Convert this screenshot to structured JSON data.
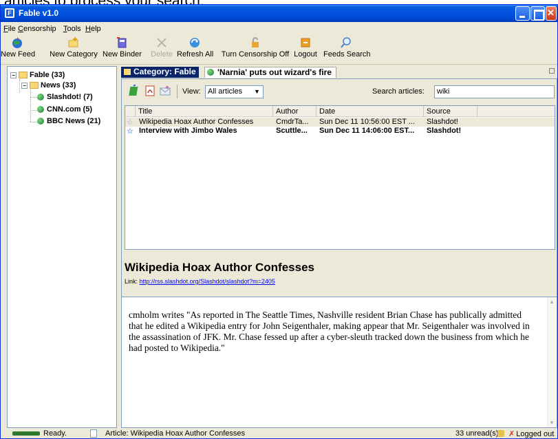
{
  "clipped_caption": "articles to process your search.",
  "window": {
    "title": "Fable v1.0"
  },
  "menu": [
    "File",
    "Censorship",
    "Tools",
    "Help"
  ],
  "toolbar": {
    "new_feed": "New Feed",
    "new_category": "New Category",
    "new_binder": "New Binder",
    "delete": "Delete",
    "refresh_all": "Refresh All",
    "turn_censorship_off": "Turn Censorship Off",
    "logout": "Logout",
    "feeds_search": "Feeds Search"
  },
  "tree": {
    "root": "Fable (33)",
    "news": "News (33)",
    "feeds": [
      "Slashdot! (7)",
      "CNN.com (5)",
      "BBC News (21)"
    ]
  },
  "tabs": {
    "active": "Category: Fable",
    "second": "'Narnia' puts out wizard's fire"
  },
  "filters": {
    "view_label": "View:",
    "view_value": "All articles",
    "search_label": "Search articles:",
    "search_value": "wiki"
  },
  "list": {
    "columns": [
      "Title",
      "Author",
      "Date",
      "Source"
    ],
    "rows": [
      {
        "title": "Wikipedia Hoax Author Confesses",
        "author": "CmdrTa...",
        "date": "Sun Dec 11 10:56:00 EST ...",
        "source": "Slashdot!",
        "unread": false
      },
      {
        "title": "Interview with Jimbo Wales",
        "author": "Scuttle...",
        "date": "Sun Dec 11 14:06:00 EST...",
        "source": "Slashdot!",
        "unread": true
      }
    ]
  },
  "article": {
    "title": "Wikipedia Hoax Author Confesses",
    "link_label": "Link:",
    "link_url": "http://rss.slashdot.org/Slashdot/slashdot?m=2405",
    "body": "cmholm writes \"As reported in The Seattle Times, Nashville resident Brian Chase has publically admitted that he edited a Wikipedia entry for John Seigenthaler, making appear that Mr. Seigenthaler was involved in the assassination of JFK. Mr. Chase fessed up after a cyber-sleuth tracked down the business from which he had posted to Wikipedia.\""
  },
  "status": {
    "ready": "Ready.",
    "article": "Article: Wikipedia Hoax Author Confesses",
    "unread": "33 unread(s)",
    "login": "Logged out"
  },
  "colors": {
    "titlebar": "#0050e0",
    "active_tab": "#0a246a",
    "link": "#0000ee"
  }
}
